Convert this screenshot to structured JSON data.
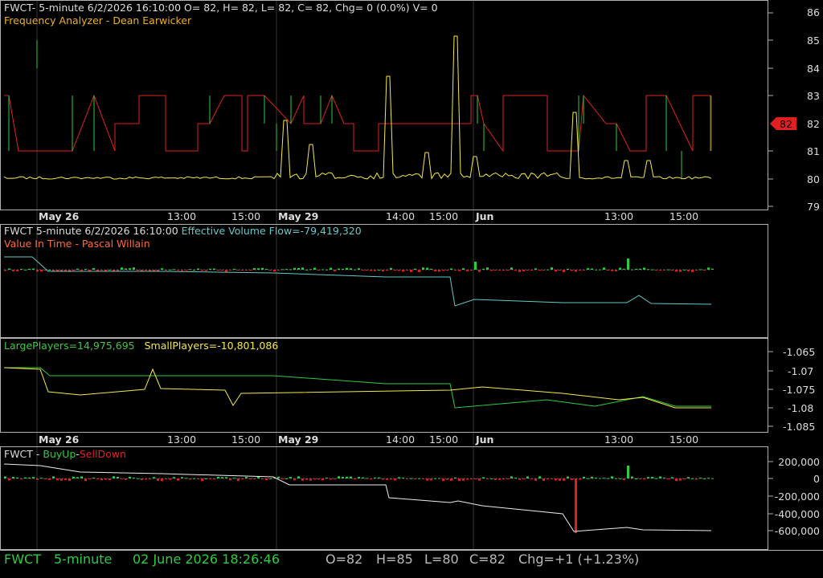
{
  "colors": {
    "bg": "#000000",
    "grid": "#333333",
    "frame": "#b0b0b0",
    "text": "#dddddd",
    "green": "#2ecc40",
    "red": "#e02020",
    "yellow": "#f5e94a",
    "cyan": "#63c9c9",
    "orange": "#ff9a1c",
    "greenLabel": "#3cc93c"
  },
  "panel1": {
    "header": "FWCT- 5-minute 6/2/2026 16:10:00 O= 82, H= 82, L= 82, C= 82, Chg= 0 (0.0%) V= 0",
    "indicator": "Frequency Analyzer - Dean Earwicker",
    "y_ticks": [
      "86",
      "85",
      "84",
      "83",
      "82",
      "81",
      "80",
      "79"
    ],
    "last_price": "82"
  },
  "time_axis": {
    "day_labels": [
      "May 26",
      "May 29",
      "Jun"
    ],
    "time_labels": [
      "13:00",
      "15:00",
      "14:00",
      "15:00",
      "13:00",
      "15:00"
    ]
  },
  "panel2": {
    "header_prefix": "FWCT 5-minute  6/2/2026 16:10:00",
    "header_value": "Effective Volume Flow=-79,419,320",
    "indicator": "Value In Time - Pascal Willain"
  },
  "panel3": {
    "large": "LargePlayers=14,975,695",
    "small": "SmallPlayers=-10,801,086",
    "y_ticks": [
      "-1.065",
      "-1.07",
      "-1.075",
      "-1.08",
      "-1.085"
    ]
  },
  "panel4": {
    "prefix": "FWCT - ",
    "buy": "BuyUp",
    "sep": "-",
    "sell": "SellDown",
    "y_ticks": [
      "200,000",
      "0",
      "-200,000",
      "-400,000",
      "-600,000"
    ]
  },
  "statusbar": {
    "symbol": "FWCT",
    "interval": "5-minute",
    "datetime": "02 June 2026 18:26:46",
    "open": "O=82",
    "high": "H=85",
    "low": "L=80",
    "close": "C=82",
    "change": "Chg=+1 (+1.23%)"
  }
}
